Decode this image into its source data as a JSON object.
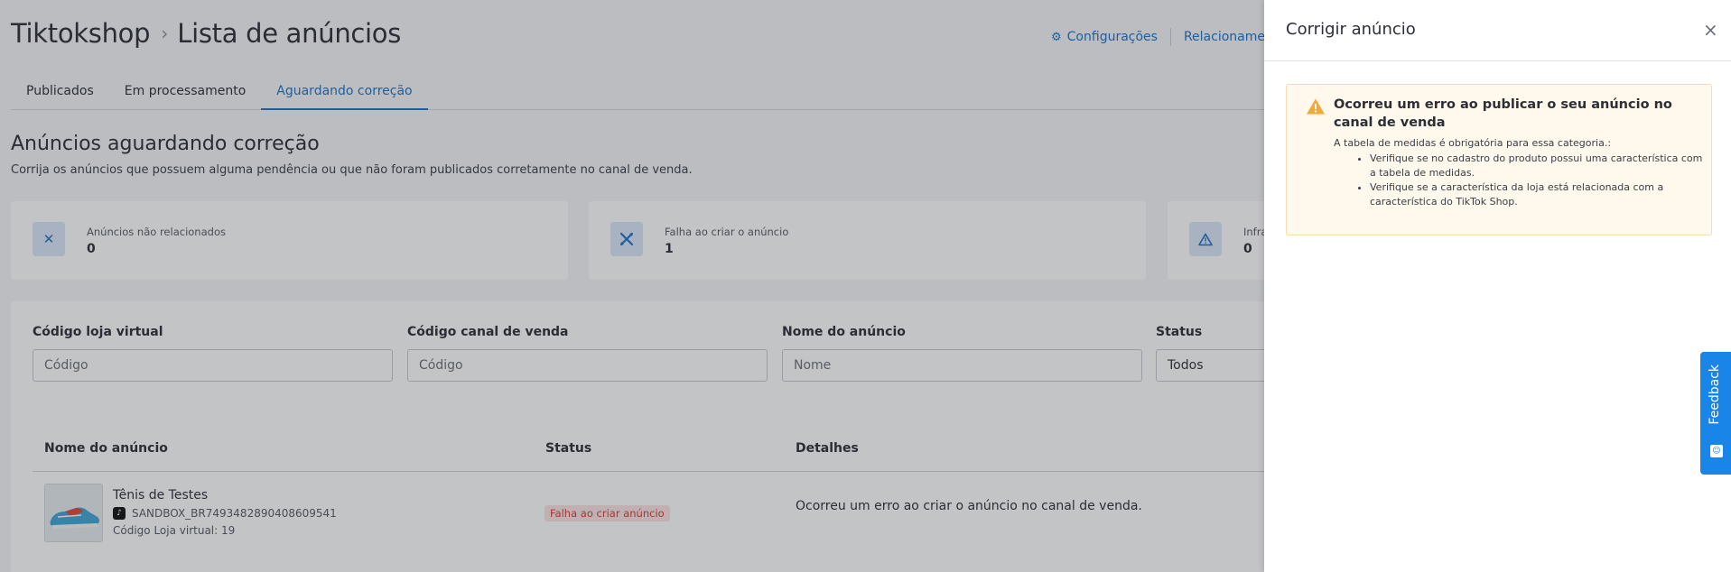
{
  "header": {
    "breadcrumb_root": "Tiktokshop",
    "breadcrumb_separator": "›",
    "breadcrumb_current": "Lista de anúncios",
    "links": {
      "settings_icon": "gear-icon",
      "settings": "Configurações",
      "relationships": "Relacionamento"
    }
  },
  "tabs": [
    {
      "label": "Publicados",
      "active": false
    },
    {
      "label": "Em processamento",
      "active": false
    },
    {
      "label": "Aguardando correção",
      "active": true
    }
  ],
  "section": {
    "title": "Anúncios aguardando correção",
    "subtitle": "Corrija os anúncios que possuem alguma pendência ou que não foram publicados corretamente no canal de venda."
  },
  "stats": [
    {
      "icon": "close-icon",
      "label": "Anúncios não relacionados",
      "value": "0"
    },
    {
      "icon": "tools-icon",
      "label": "Falha ao criar o anúncio",
      "value": "1"
    },
    {
      "icon": "warning-icon",
      "label": "Infra",
      "value": "0"
    }
  ],
  "filters": {
    "store_code": {
      "label": "Código loja virtual",
      "placeholder": "Código"
    },
    "channel_code": {
      "label": "Código canal de venda",
      "placeholder": "Código"
    },
    "name": {
      "label": "Nome do anúncio",
      "placeholder": "Nome"
    },
    "status": {
      "label": "Status",
      "value": "Todos"
    }
  },
  "table": {
    "columns": [
      "Nome do anúncio",
      "Status",
      "Detalhes"
    ],
    "rows": [
      {
        "name": "Tênis de Testes",
        "channel_code": "SANDBOX_BR7493482890408609541",
        "store_code": "Código Loja virtual: 19",
        "status": "Falha ao criar anúncio",
        "details": "Ocorreu um erro ao criar o anúncio no canal de venda."
      }
    ]
  },
  "drawer": {
    "title": "Corrigir anúncio",
    "close": "×",
    "alert": {
      "title": "Ocorreu um erro ao publicar o seu anúncio no canal de venda",
      "text": "A tabela de medidas é obrigatória para essa categoria.:",
      "items": [
        "Verifique se no cadastro do produto possui uma característica com a tabela de medidas.",
        "Verifique se a característica da loja está relacionada com a característica do TikTok Shop."
      ]
    }
  },
  "feedback": {
    "label": "Feedback"
  },
  "colors": {
    "accent": "#1a73c9",
    "error": "#d9383a",
    "warning": "#f2a93b",
    "feedback": "#1a85e8"
  }
}
